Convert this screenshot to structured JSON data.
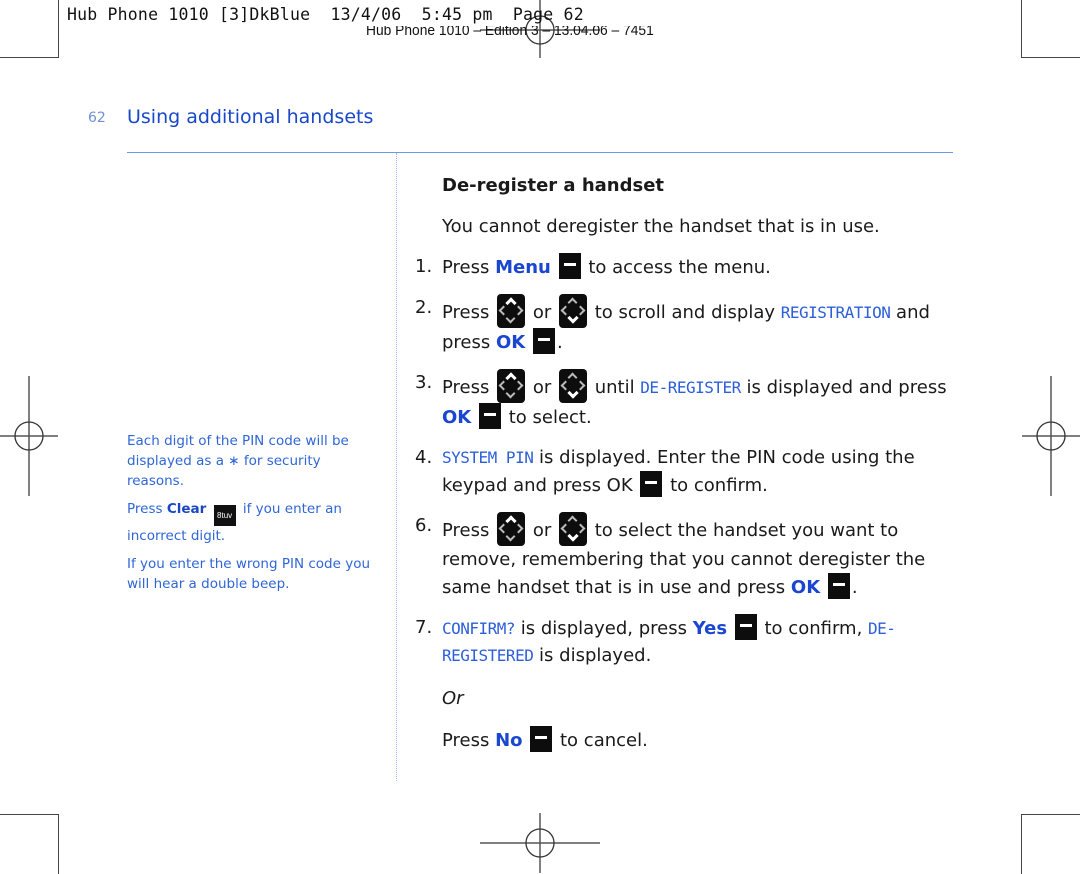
{
  "slug": {
    "line1": "Hub Phone 1010 [3]DkBlue  13/4/06  5:45 pm  Page 62",
    "line2": "Hub Phone 1010 – Edition 3 – 13.04.06 – 7451"
  },
  "header": {
    "page_number": "62",
    "section_title": "Using additional handsets"
  },
  "sidebar": {
    "note1": "Each digit of the PIN code will be displayed as a ∗ for security reasons.",
    "note2_prefix": "Press ",
    "note2_key": "Clear",
    "note2_keycap": "8tuv",
    "note2_suffix": " if you enter an incorrect digit.",
    "note3": "If you enter the wrong PIN code you will hear a double beep."
  },
  "main": {
    "heading": "De-register a handset",
    "intro": "You cannot deregister the handset that is in use.",
    "steps": [
      {
        "num": "1.",
        "press": "Press ",
        "key": "Menu",
        "rest": " to access the menu."
      },
      {
        "num": "2.",
        "press": "Press ",
        "or": " or ",
        "mid": " to scroll and display ",
        "lcd": "REGISTRATION",
        "and": " and press ",
        "key": "OK",
        "end": "."
      },
      {
        "num": "3.",
        "press": "Press ",
        "or": " or ",
        "mid": " until ",
        "lcd": "DE-REGISTER",
        "and": " is displayed and press ",
        "key": "OK",
        "end": " to select."
      },
      {
        "num": "4.",
        "lcd": "SYSTEM PIN",
        "text": " is displayed. Enter the PIN code using the keypad and press OK ",
        "end": " to confirm."
      },
      {
        "num": "6.",
        "press": "Press ",
        "or": " or ",
        "mid": " to select the handset you want to remove, remembering that you cannot deregister the same handset that is in use and press ",
        "key": "OK",
        "end": "."
      },
      {
        "num": "7.",
        "lcd": "CONFIRM?",
        "text": " is displayed, press ",
        "key": "Yes",
        "mid": " to confirm, ",
        "lcd2": "DE-REGISTERED",
        "end": " is displayed."
      }
    ],
    "or_text": "Or",
    "cancel": {
      "press": "Press ",
      "key": "No",
      "end": " to cancel."
    }
  },
  "icons": {
    "softkey": "softkey-minus-icon",
    "nav_up": "nav-key-up-icon",
    "nav_down": "nav-key-down-icon",
    "keypad": "keypad-8-icon"
  }
}
